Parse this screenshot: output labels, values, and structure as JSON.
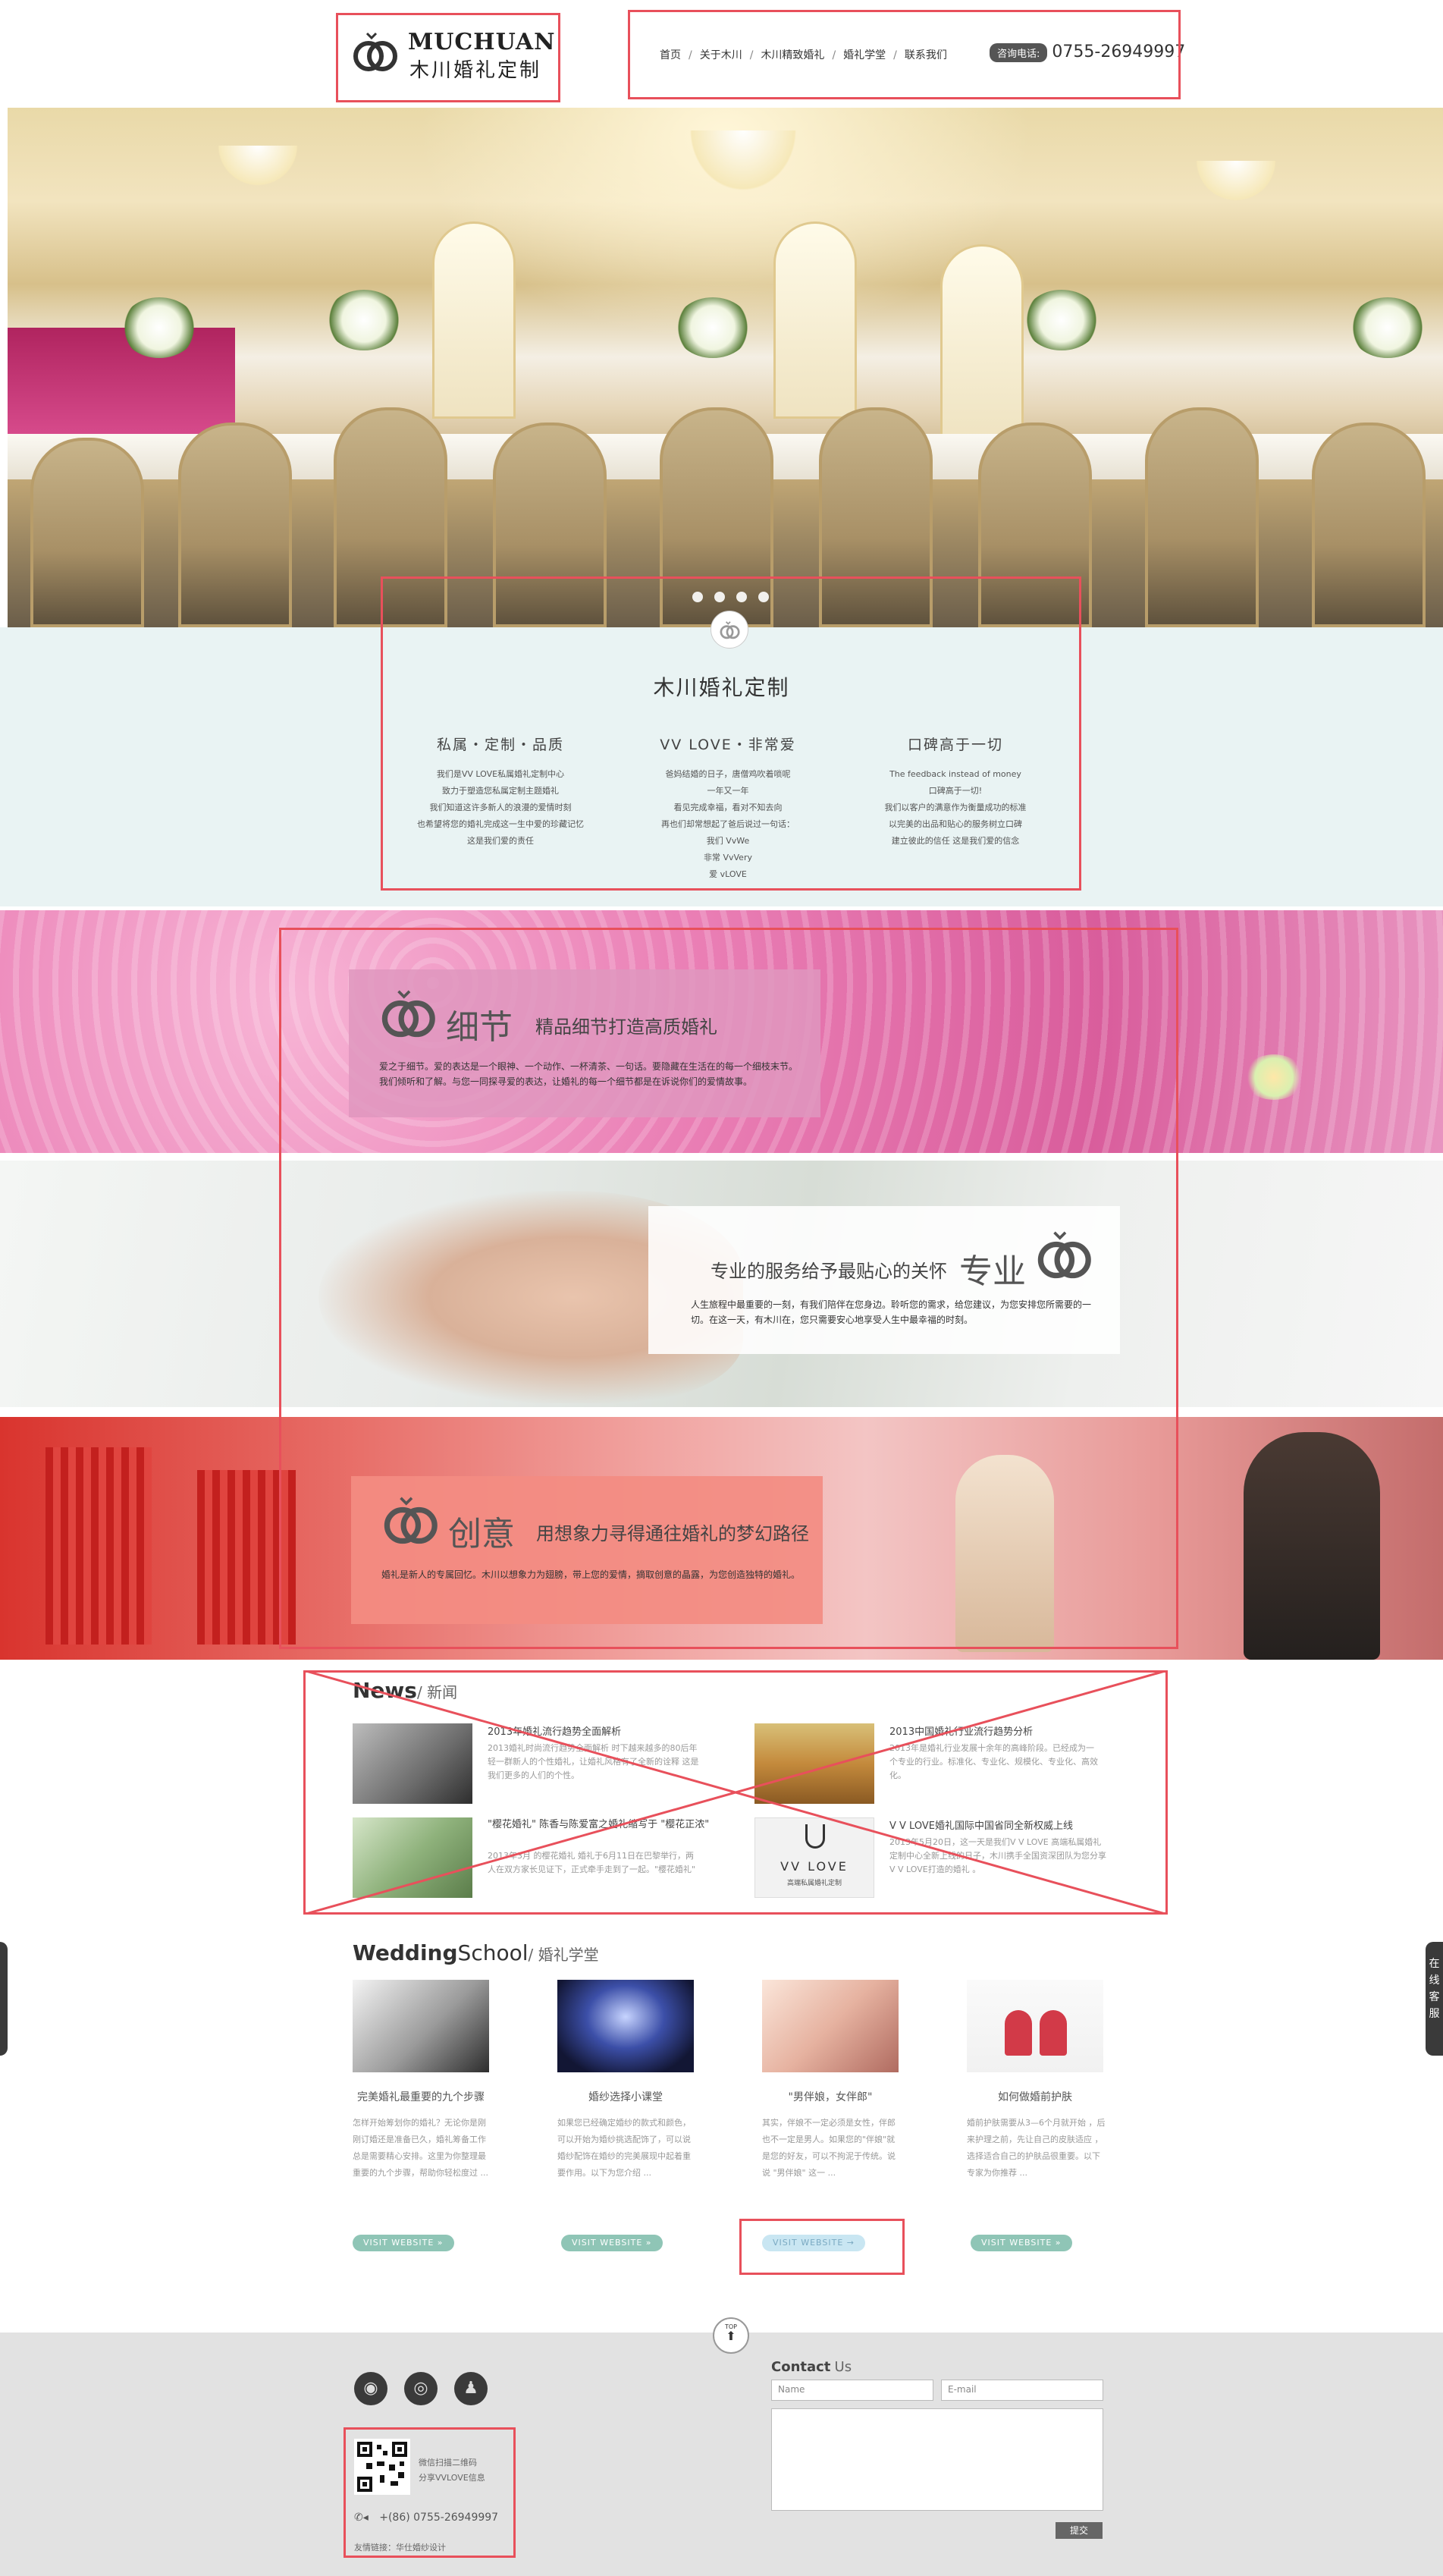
{
  "header": {
    "logo_en": "MUCHUAN",
    "logo_cn": "木川婚礼定制",
    "nav": [
      "首页",
      "关于木川",
      "木川精致婚礼",
      "婚礼学堂",
      "联系我们"
    ],
    "hotline_label": "咨询电话:",
    "hotline_number": "0755-26949997"
  },
  "hero": {
    "slide_count": 4
  },
  "intro": {
    "title": "木川婚礼定制",
    "columns": [
      {
        "title": "私属・定制・品质",
        "lines": [
          "我们是VV LOVE私属婚礼定制中心",
          "致力于塑造您私属定制主题婚礼",
          "我们知道这许多新人的浪漫的爱情时刻",
          "也希望将您的婚礼完成这一生中爱的珍藏记忆",
          "这是我们爱的责任"
        ]
      },
      {
        "title": "VV LOVE・非常爱",
        "lines": [
          "爸妈结婚的日子，唐僧鸡吹着唢呢",
          "一年又一年",
          "看见完成幸福，看对不知去向",
          "再也们却常想起了爸后说过一句话：",
          "我们 VvWe",
          "非常 VvVery",
          "爱 vLOVE"
        ]
      },
      {
        "title": "口碑高于一切",
        "lines": [
          "The feedback instead of money",
          "口碑高于一切!",
          "我们以客户的满意作为衡量成功的标准",
          "以完美的出品和贴心的服务树立口碑",
          "建立彼此的信任 这是我们爱的信念"
        ]
      }
    ]
  },
  "features": [
    {
      "title": "细节",
      "subtitle": "精品细节打造高质婚礼",
      "text": "爱之于细节。爱的表达是一个眼神、一个动作、一杯清茶、一句话。要隐藏在生活在的每一个细枝末节。我们倾听和了解。与您一同探寻爱的表达，让婚礼的每一个细节都是在诉说你们的爱情故事。"
    },
    {
      "title": "专业",
      "subtitle": "专业的服务给予最贴心的关怀",
      "text": "人生旅程中最重要的一刻，有我们陪伴在您身边。聆听您的需求，给您建议，为您安排您所需要的一切。在这一天，有木川在，您只需要安心地享受人生中最幸福的时刻。"
    },
    {
      "title": "创意",
      "subtitle": "用想象力寻得通往婚礼的梦幻路径",
      "text": "婚礼是新人的专属回忆。木川以想象力为翅膀，带上您的爱情，摘取创意的晶露，为您创造独特的婚礼。"
    }
  ],
  "news": {
    "heading": "News",
    "heading_cn": "/ 新闻",
    "items": [
      {
        "title": "2013年婚礼流行趋势全面解析",
        "text": "2013婚礼时尚流行趋势全面解析 时下越来越多的80后年轻一群新人的个性婚礼，让婚礼风格有了全新的诠释 这是我们更多的人们的个性。"
      },
      {
        "title": "2013中国婚礼行业流行趋势分析",
        "text": "2013年是婚礼行业发展十余年的高峰阶段。已经成为一个专业的行业。标准化、专业化、规模化、专业化、高效化。"
      },
      {
        "title": "\"樱花婚礼\" 陈香与陈爱富之婚礼缩写于 \"樱花正浓\"",
        "text": "2013年3月 的樱花婚礼 婚礼于6月11日在巴黎举行，两人在双方家长见证下，正式牵手走到了一起。\"樱花婚礼\""
      },
      {
        "title": "V V LOVE婚礼国际中国省同全新权威上线",
        "text": "2013年5月20日，这一天是我们V V LOVE 高端私属婚礼定制中心全新上线的日子，木川携手全国资深团队为您分享V V LOVE打造的婚礼 。"
      }
    ],
    "vvlove_caption_main": "VV LOVE",
    "vvlove_caption_sub": "高端私属婚礼定制"
  },
  "school": {
    "heading": "Wedding",
    "heading2": "School",
    "heading_cn": "/ 婚礼学堂",
    "items": [
      {
        "title": "完美婚礼最重要的九个步骤",
        "text": "怎样开始筹划你的婚礼？无论你是刚刚订婚还是准备已久，婚礼筹备工作总是需要精心安排。这里为你整理最重要的九个步骤，帮助你轻松度过 ..."
      },
      {
        "title": "婚纱选择小课堂",
        "text": "如果您已经确定婚纱的款式和颜色，可以开始为婚纱挑选配饰了，可以说婚纱配饰在婚纱的完美展现中起着重要作用。以下为您介绍 ..."
      },
      {
        "title": "\"男伴娘，女伴郎\"",
        "text": "其实，伴娘不一定必须是女性，伴郎也不一定是男人。如果您的\"伴娘\"就是您的好友，可以不拘泥于传统。说说 \"男伴娘\" 这一 ..."
      },
      {
        "title": "如何做婚前护肤",
        "text": "婚前护肤需要从3—6个月就开始 ，后来护理之前，先让自己的皮肤适应 ，选择适合自己的护肤品很重要。以下专家为你推荐 ..."
      }
    ],
    "visit_label": "VISIT WEBSITE"
  },
  "footer": {
    "top_label": "TOP",
    "qr_line1": "微信扫描二维码",
    "qr_line2": "分享VVLOVE信息",
    "phone": "+(86) 0755-26949997",
    "links_text": "友情链接：华仕婚纱设计",
    "contact_title": "Contact",
    "contact_title2": "Us",
    "name_placeholder": "Name",
    "email_placeholder": "E-mail",
    "submit_label": "提交"
  },
  "side_tab": {
    "text": "在线客服"
  },
  "colors": {
    "annotation_red": "#e8505b",
    "intro_bg": "#e9f3f3",
    "feature1_box": "#e3a0c0",
    "feature3_box": "#f2a49a",
    "visit_green": "#8fc5b6",
    "visit_blue": "#c9e6f2",
    "footer_bg": "#e2e2e2"
  },
  "icons": [
    "wechat-icon",
    "weibo-icon",
    "qq-icon",
    "phone-icon",
    "rings-logo-icon",
    "arrow-up-icon"
  ]
}
